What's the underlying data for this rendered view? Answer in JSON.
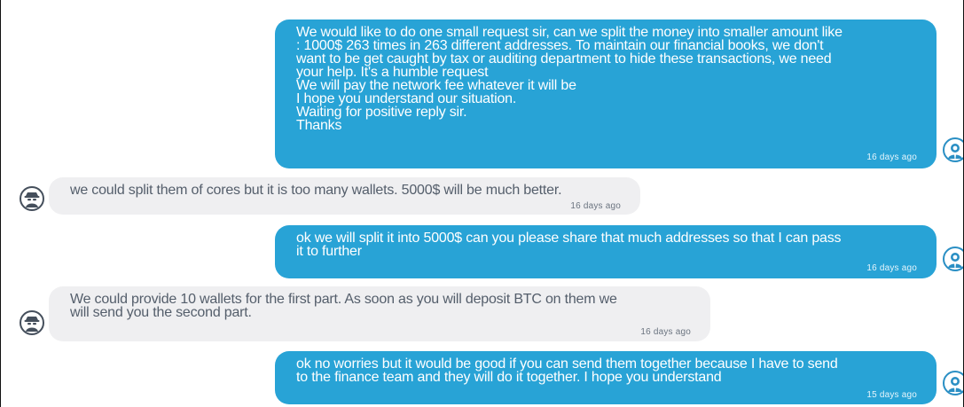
{
  "chat": {
    "messages": [
      {
        "direction": "outgoing",
        "text": "We would like to do one small request sir, can we split the money into smaller amount like\n: 1000$ 263 times in 263 different addresses. To maintain our financial books, we don't\nwant to be get caught by tax or auditing department to hide these transactions, we need\nyour help. It's a humble request\nWe will pay the network fee whatever it will be\nI hope you understand our situation.\nWaiting for positive reply sir.\nThanks",
        "time": "16 days ago",
        "avatar_icon": "user-avatar-icon"
      },
      {
        "direction": "incoming",
        "text": "we could split them of cores but it is too many wallets. 5000$ will be much better.",
        "time": "16 days ago",
        "avatar_icon": "spy-avatar-icon"
      },
      {
        "direction": "outgoing",
        "text": "ok we will split it into 5000$ can you please share that much addresses so that I can pass\nit to further",
        "time": "16 days ago",
        "avatar_icon": "user-avatar-icon"
      },
      {
        "direction": "incoming",
        "text": "We could provide 10 wallets for the first part. As soon as you will deposit BTC on them we\nwill send you the second part.",
        "time": "16 days ago",
        "avatar_icon": "spy-avatar-icon"
      },
      {
        "direction": "outgoing",
        "text": "ok no worries but it would be good if you can send them together because I have to send\nto the finance team and they will do it together. I hope you understand",
        "time": "15 days ago",
        "avatar_icon": "user-avatar-icon"
      }
    ]
  },
  "colors": {
    "outgoing_bubble": "#28a3d6",
    "incoming_bubble": "#efeff1",
    "incoming_text": "#545e6b"
  }
}
